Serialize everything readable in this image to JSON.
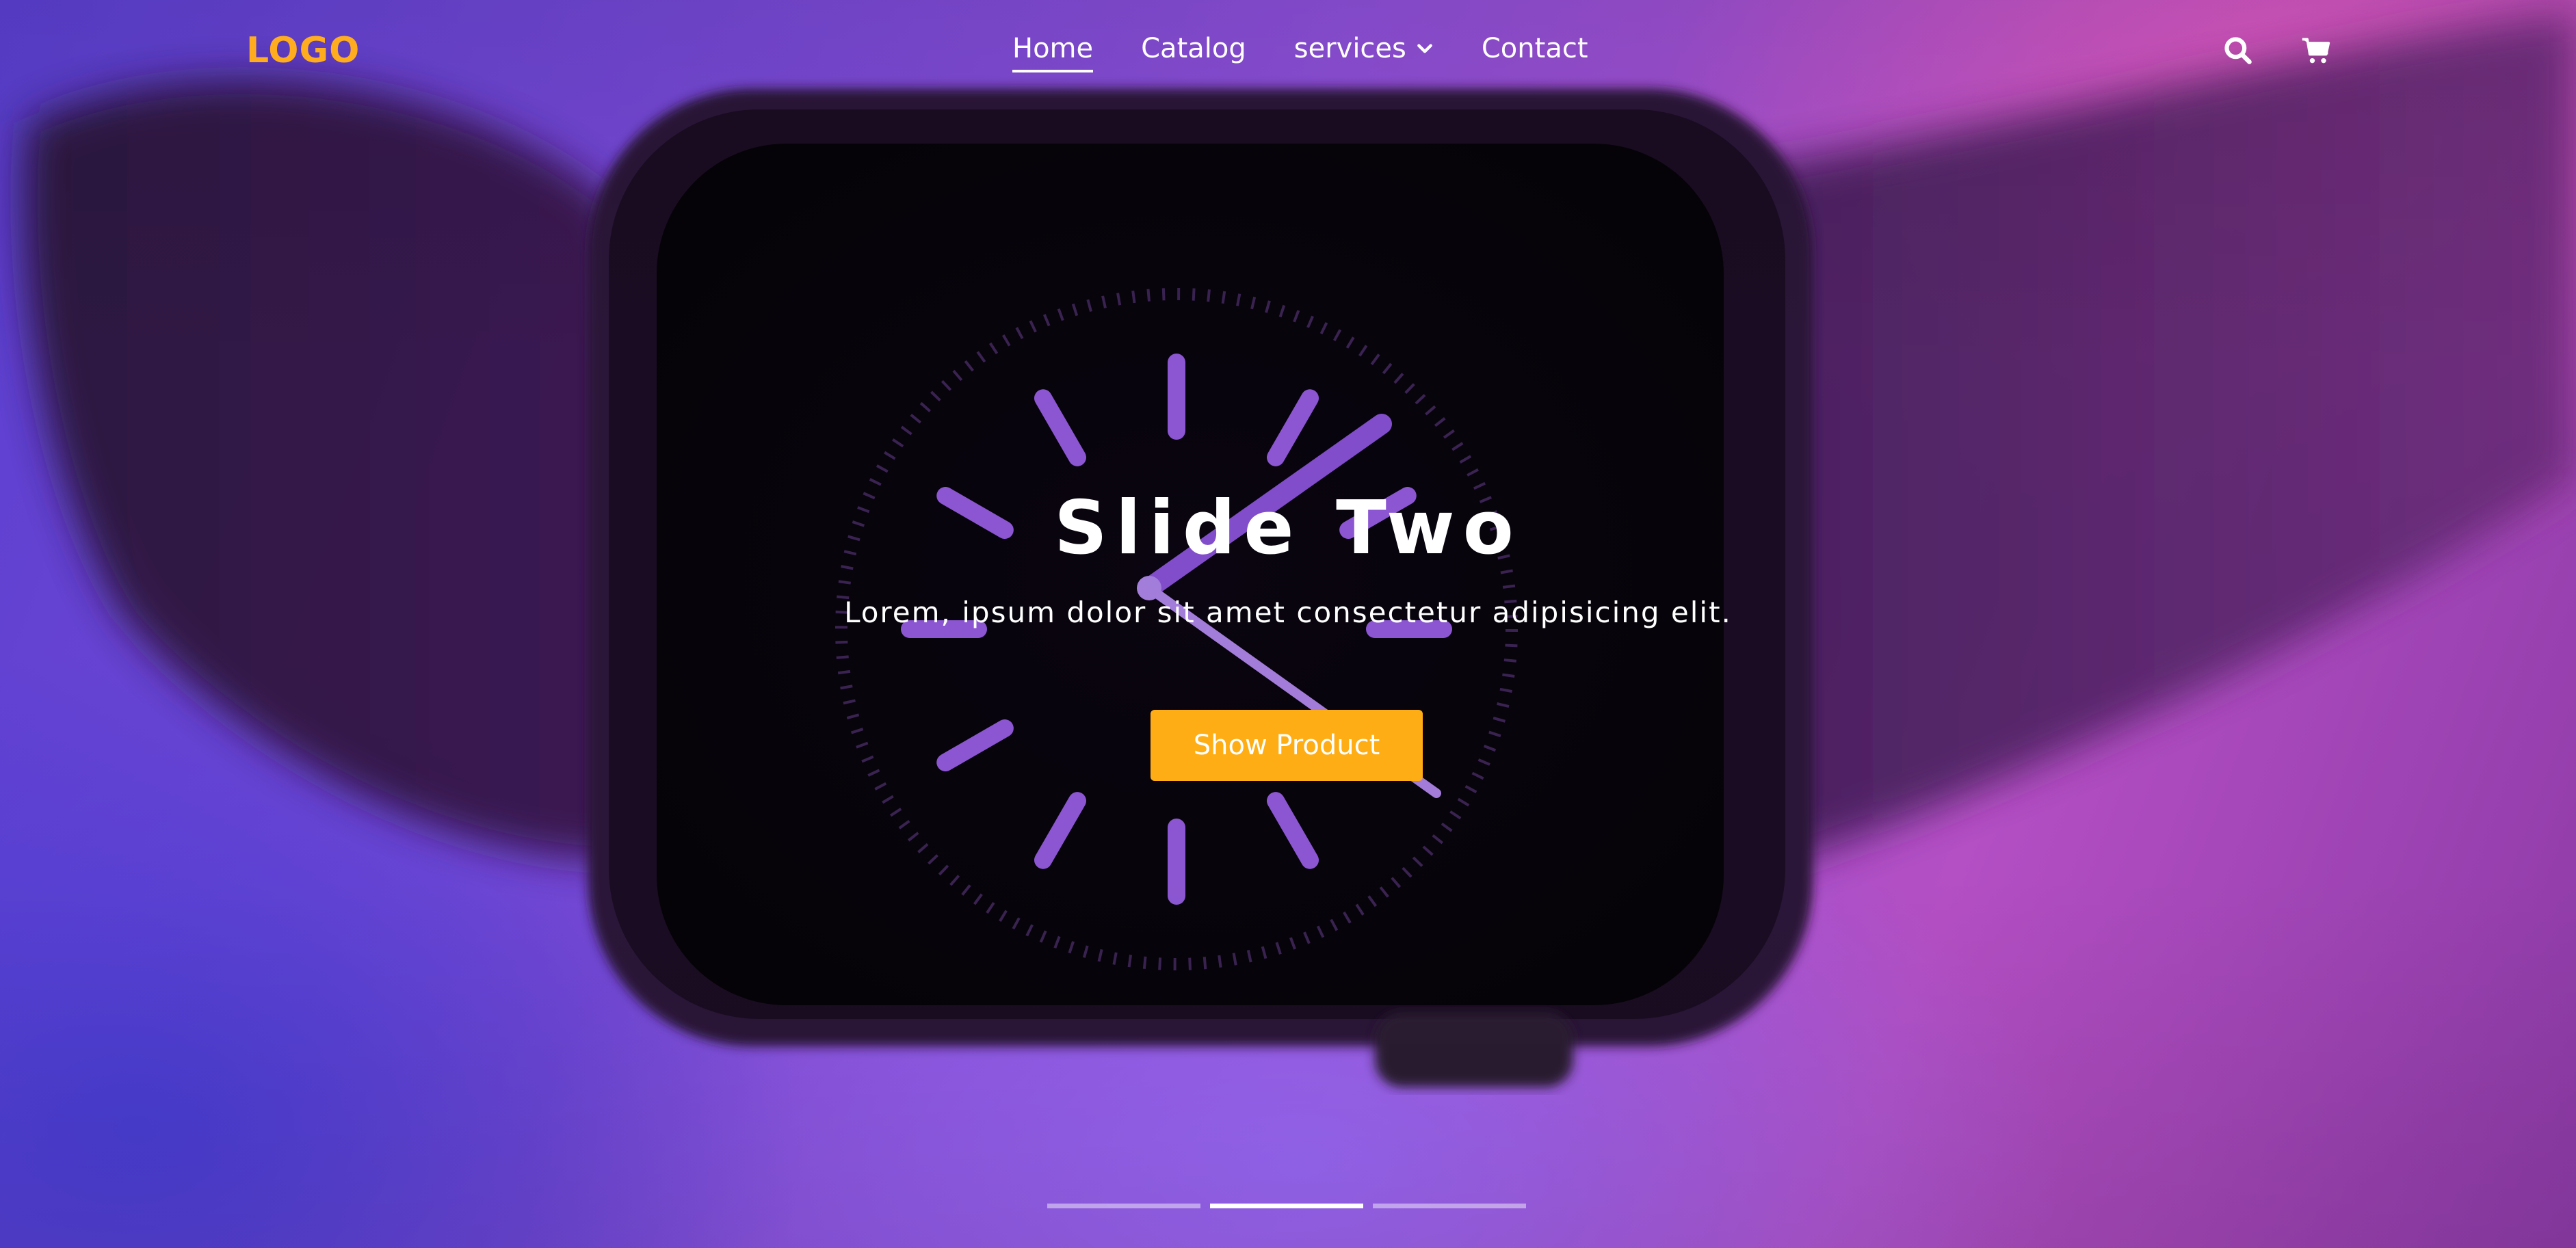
{
  "brand": {
    "logo_text": "LOGO",
    "accent_color": "#ffad14"
  },
  "nav": {
    "items": [
      {
        "label": "Home",
        "active": true
      },
      {
        "label": "Catalog",
        "active": false
      },
      {
        "label": "services",
        "active": false,
        "has_dropdown": true
      },
      {
        "label": "Contact",
        "active": false
      }
    ],
    "icons": [
      "search-icon",
      "cart-icon"
    ]
  },
  "slide": {
    "title": "Slide Two",
    "subtitle": "Lorem, ipsum dolor sit amet consectetur adipisicing elit.",
    "button_label": "Show Product",
    "active_index": 2,
    "count": 3
  },
  "colors": {
    "indicator_active": "#ffffff",
    "indicator_inactive": "rgba(255,255,255,0.45)",
    "title": "#ffffff"
  }
}
